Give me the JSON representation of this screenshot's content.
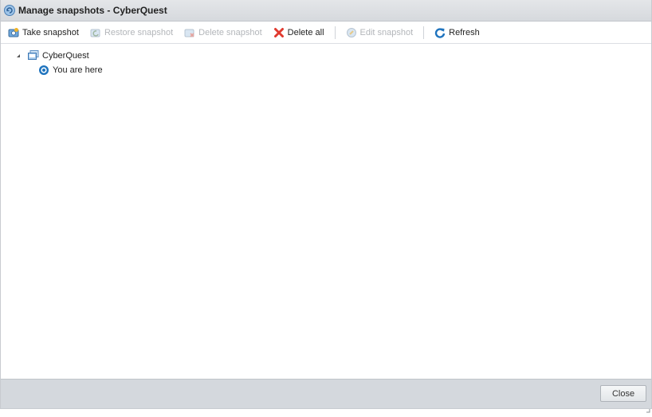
{
  "window": {
    "title": "Manage snapshots - CyberQuest"
  },
  "toolbar": {
    "take_snapshot": "Take snapshot",
    "restore_snapshot": "Restore snapshot",
    "delete_snapshot": "Delete snapshot",
    "delete_all": "Delete all",
    "edit_snapshot": "Edit snapshot",
    "refresh": "Refresh"
  },
  "tree": {
    "root": "CyberQuest",
    "current": "You are here"
  },
  "footer": {
    "close_label": "Close"
  },
  "colors": {
    "accent": "#1e73be",
    "delete": "#e03a2f",
    "disabled_text": "#b3b6ba",
    "footer_bg": "#d4d8dd"
  }
}
